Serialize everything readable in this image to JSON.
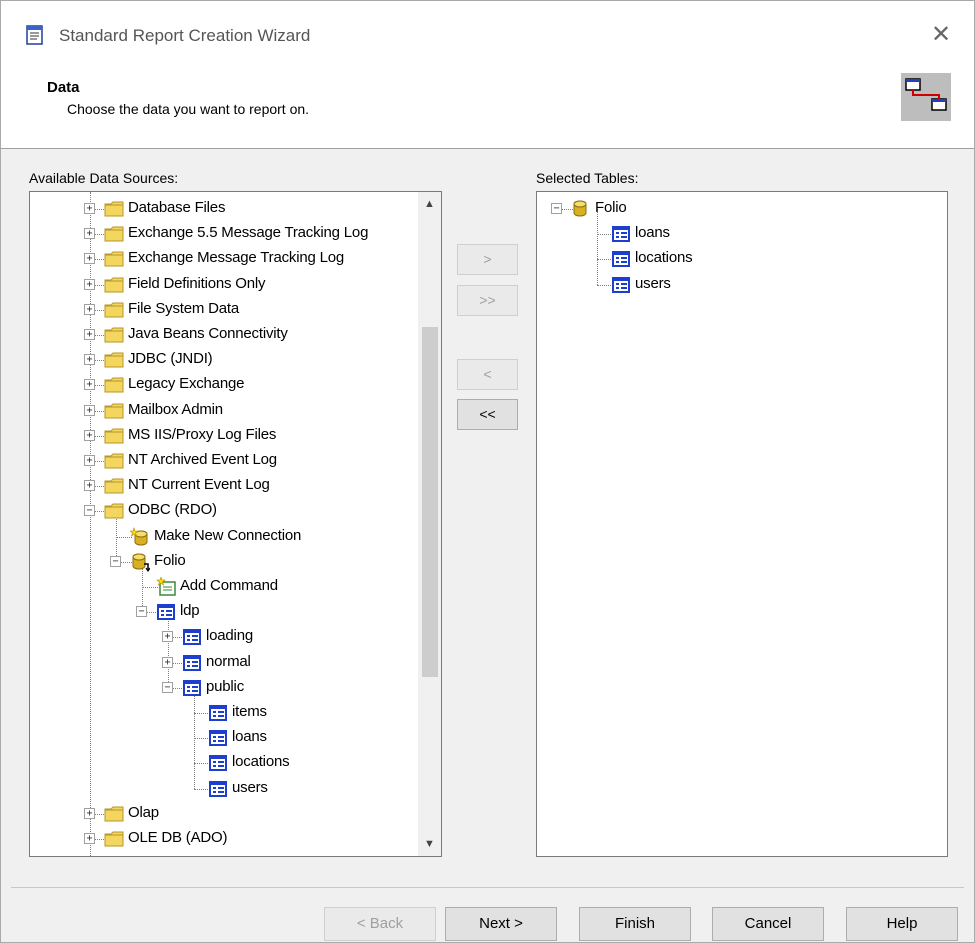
{
  "window": {
    "title": "Standard Report Creation Wizard",
    "close_symbol": "✕"
  },
  "header": {
    "title": "Data",
    "subtitle": "Choose the data you want to report on."
  },
  "available": {
    "label": "Available Data Sources:",
    "items": [
      {
        "text": "Database Files",
        "icon": "folder-icon",
        "level": 0,
        "state": "collapsed"
      },
      {
        "text": "Exchange 5.5 Message Tracking Log",
        "icon": "folder-icon",
        "level": 0,
        "state": "collapsed"
      },
      {
        "text": "Exchange Message Tracking Log",
        "icon": "folder-icon",
        "level": 0,
        "state": "collapsed"
      },
      {
        "text": "Field Definitions Only",
        "icon": "folder-icon",
        "level": 0,
        "state": "collapsed"
      },
      {
        "text": "File System Data",
        "icon": "folder-icon",
        "level": 0,
        "state": "collapsed"
      },
      {
        "text": "Java Beans Connectivity",
        "icon": "folder-icon",
        "level": 0,
        "state": "collapsed"
      },
      {
        "text": "JDBC (JNDI)",
        "icon": "folder-icon",
        "level": 0,
        "state": "collapsed"
      },
      {
        "text": "Legacy Exchange",
        "icon": "folder-icon",
        "level": 0,
        "state": "collapsed"
      },
      {
        "text": "Mailbox Admin",
        "icon": "folder-icon",
        "level": 0,
        "state": "collapsed"
      },
      {
        "text": "MS IIS/Proxy Log Files",
        "icon": "folder-icon",
        "level": 0,
        "state": "collapsed"
      },
      {
        "text": "NT Archived Event Log",
        "icon": "folder-icon",
        "level": 0,
        "state": "collapsed"
      },
      {
        "text": "NT Current Event Log",
        "icon": "folder-icon",
        "level": 0,
        "state": "collapsed"
      },
      {
        "text": "ODBC (RDO)",
        "icon": "folder-icon",
        "level": 0,
        "state": "expanded"
      },
      {
        "text": "Make New Connection",
        "icon": "new-connection-icon",
        "level": 1,
        "state": "leaf"
      },
      {
        "text": "Folio",
        "icon": "database-connection-icon",
        "level": 1,
        "state": "expanded"
      },
      {
        "text": "Add Command",
        "icon": "add-command-icon",
        "level": 2,
        "state": "leaf"
      },
      {
        "text": "ldp",
        "icon": "table-icon",
        "level": 2,
        "state": "expanded"
      },
      {
        "text": "loading",
        "icon": "table-icon",
        "level": 3,
        "state": "collapsed"
      },
      {
        "text": "normal",
        "icon": "table-icon",
        "level": 3,
        "state": "collapsed"
      },
      {
        "text": "public",
        "icon": "table-icon",
        "level": 3,
        "state": "expanded"
      },
      {
        "text": "items",
        "icon": "table-icon",
        "level": 4,
        "state": "leaf"
      },
      {
        "text": "loans",
        "icon": "table-icon",
        "level": 4,
        "state": "leaf"
      },
      {
        "text": "locations",
        "icon": "table-icon",
        "level": 4,
        "state": "leaf"
      },
      {
        "text": "users",
        "icon": "table-icon",
        "level": 4,
        "state": "leaf"
      },
      {
        "text": "Olap",
        "icon": "folder-icon",
        "level": 0,
        "state": "collapsed"
      },
      {
        "text": "OLE DB (ADO)",
        "icon": "folder-icon",
        "level": 0,
        "state": "collapsed"
      }
    ]
  },
  "selected": {
    "label": "Selected Tables:",
    "items": [
      {
        "text": "Folio",
        "icon": "database-icon",
        "level": 0,
        "state": "expanded"
      },
      {
        "text": "loans",
        "icon": "table-icon",
        "level": 1,
        "state": "leaf"
      },
      {
        "text": "locations",
        "icon": "table-icon",
        "level": 1,
        "state": "leaf"
      },
      {
        "text": "users",
        "icon": "table-icon",
        "level": 1,
        "state": "leaf"
      }
    ]
  },
  "move_buttons": {
    "add": ">",
    "add_all": ">>",
    "remove": "<",
    "remove_all": "<<"
  },
  "footer": {
    "back": "< Back",
    "next": "Next >",
    "finish": "Finish",
    "cancel": "Cancel",
    "help": "Help"
  },
  "colors": {
    "folder": "#f2d65e",
    "folder_edge": "#b8962a",
    "table_blue": "#1d3fd0",
    "database_gold": "#d8b020"
  }
}
